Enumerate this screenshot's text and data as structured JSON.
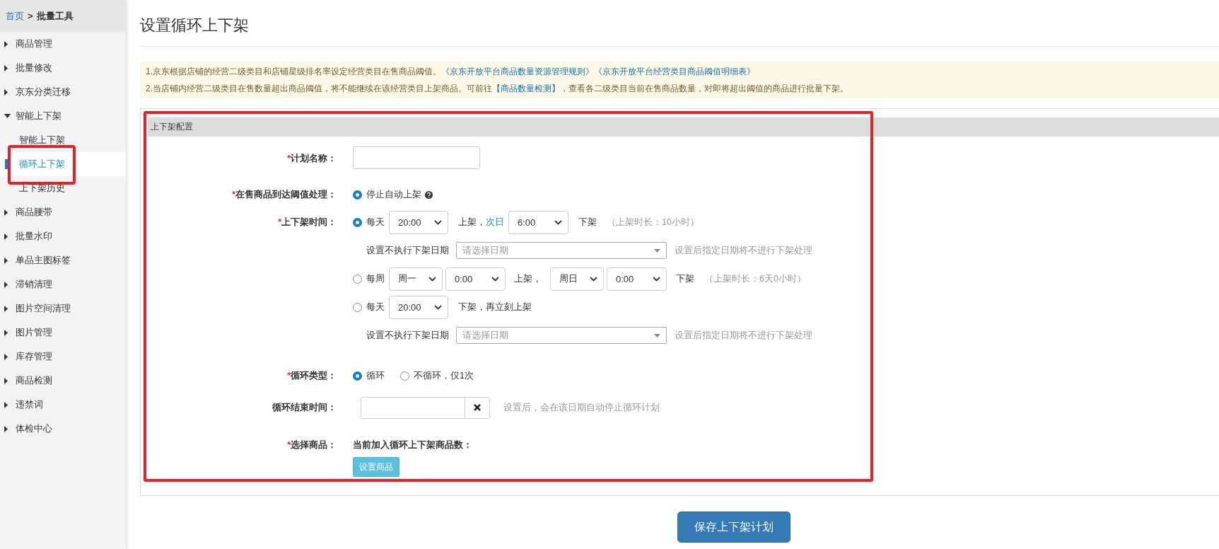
{
  "breadcrumb": {
    "home": "首页",
    "separator": ">",
    "current": "批量工具"
  },
  "sidebar": {
    "items": [
      {
        "label": "商品管理",
        "expanded": false
      },
      {
        "label": "批量修改",
        "expanded": false
      },
      {
        "label": "京东分类迁移",
        "expanded": false
      },
      {
        "label": "智能上下架",
        "expanded": true,
        "children": [
          {
            "label": "智能上下架",
            "selected": false,
            "highlighted": false
          },
          {
            "label": "循环上下架",
            "selected": true,
            "highlighted": true
          },
          {
            "label": "上下架历史",
            "selected": false,
            "highlighted": false
          }
        ]
      },
      {
        "label": "商品腰带",
        "expanded": false
      },
      {
        "label": "批量水印",
        "expanded": false
      },
      {
        "label": "单品主图标签",
        "expanded": false
      },
      {
        "label": "滞销清理",
        "expanded": false
      },
      {
        "label": "图片空间清理",
        "expanded": false
      },
      {
        "label": "图片管理",
        "expanded": false
      },
      {
        "label": "库存管理",
        "expanded": false
      },
      {
        "label": "商品检测",
        "expanded": false
      },
      {
        "label": "违禁词",
        "expanded": false
      },
      {
        "label": "体检中心",
        "expanded": false
      }
    ]
  },
  "page_title": "设置循环上下架",
  "notice": [
    {
      "parts": [
        {
          "kind": "text",
          "text": "1.京东根据店铺的经营二级类目和店铺星级排名率设定经营类目在售商品阈值。"
        },
        {
          "kind": "link",
          "text": "《京东开放平台商品数量资源管理规则》"
        },
        {
          "kind": "link",
          "text": "《京东开放平台经营类目商品阈值明细表》"
        }
      ]
    },
    {
      "parts": [
        {
          "kind": "text",
          "text": "2.当店铺内经营二级类目在售数量超出商品阈值，将不能继续在该经营类目上架商品。可前往"
        },
        {
          "kind": "link",
          "text": "【商品数量检测】"
        },
        {
          "kind": "text",
          "text": "，查看各二级类目当前在售商品数量，对即将超出阈值的商品进行批量下架。"
        }
      ]
    }
  ],
  "config": {
    "title": "上下架配置",
    "highlighted": true,
    "plan_name": {
      "asterisk": "*",
      "label": "计划名称："
    },
    "threshold": {
      "asterisk": "*",
      "label": "在售商品到达阈值处理：",
      "options": [
        {
          "label": "停止自动上架",
          "selected": true
        }
      ]
    },
    "schedule": {
      "asterisk": "*",
      "label": "上下架时间：",
      "options": [
        {
          "kind": "daily",
          "selected": true,
          "prefix": "每天",
          "on_time": "20:00",
          "on_text": "上架，",
          "next_day": "次日",
          "off_time": "6:00",
          "off_text": "下架",
          "duration": "（上架时长：10小时）",
          "exclude": {
            "label": "设置不执行下架日期",
            "placeholder": "请选择日期",
            "hint": "设置后指定日期将不进行下架处理"
          }
        },
        {
          "kind": "weekly",
          "selected": false,
          "prefix": "每周",
          "on_day": "周一",
          "on_time": "0:00",
          "on_text": "上架，",
          "off_day": "周日",
          "off_time": "0:00",
          "off_text": "下架",
          "duration": "（上架时长：6天0小时）"
        },
        {
          "kind": "relist",
          "selected": false,
          "prefix": "每天",
          "off_time": "20:00",
          "off_text": "下架，再立刻上架",
          "exclude": {
            "label": "设置不执行下架日期",
            "placeholder": "请选择日期",
            "hint": "设置后指定日期将不进行下架处理"
          }
        }
      ]
    },
    "loop_type": {
      "asterisk": "*",
      "label": "循环类型：",
      "options": [
        {
          "label": "循环",
          "selected": true
        },
        {
          "label": "不循环，仅1次",
          "selected": false
        }
      ]
    },
    "end_time": {
      "label": "循环结束时间：",
      "hint": "设置后，会在该日期自动停止循环计划"
    },
    "goods": {
      "asterisk": "*",
      "label": "选择商品：",
      "count_label": "当前加入循环上下架商品数：",
      "button": "设置商品"
    }
  },
  "save_button": "保存上下架计划"
}
